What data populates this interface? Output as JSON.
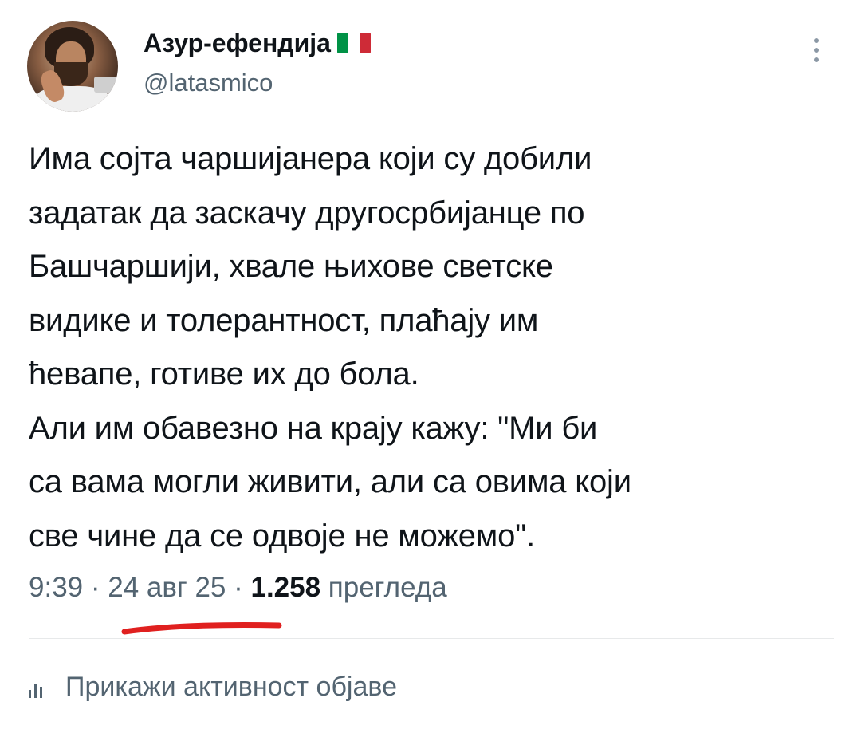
{
  "author": {
    "display_name": "Азур-ефендија",
    "handle": "@latasmico",
    "flag_colors": [
      "#009246",
      "#ffffff",
      "#ce2b37"
    ],
    "avatar": "user-avatar-photo"
  },
  "tweet": {
    "text": "Има сојта чаршијанера који су добили\nзадатак да заскачу другосрбијанце по\nБашчаршији, хвале њихове светске\nвидике и толерантност, плаћају им\nћевапе, готиве их до бола.\nАли им обавезно на крају кажу: \"Ми би\nса вама могли живити, али са овима који\nсве чине да се одвоје не можемо\"."
  },
  "meta": {
    "time": "9:39",
    "separator": " · ",
    "date": "24 авг 25",
    "views_count": "1.258",
    "views_label": " прегледа"
  },
  "annotation": {
    "underline_color": "#e0201f"
  },
  "actions": {
    "more_icon": "more-vertical-icon",
    "activity_icon": "bar-chart-icon",
    "activity_label": "Прикажи активност објаве"
  }
}
